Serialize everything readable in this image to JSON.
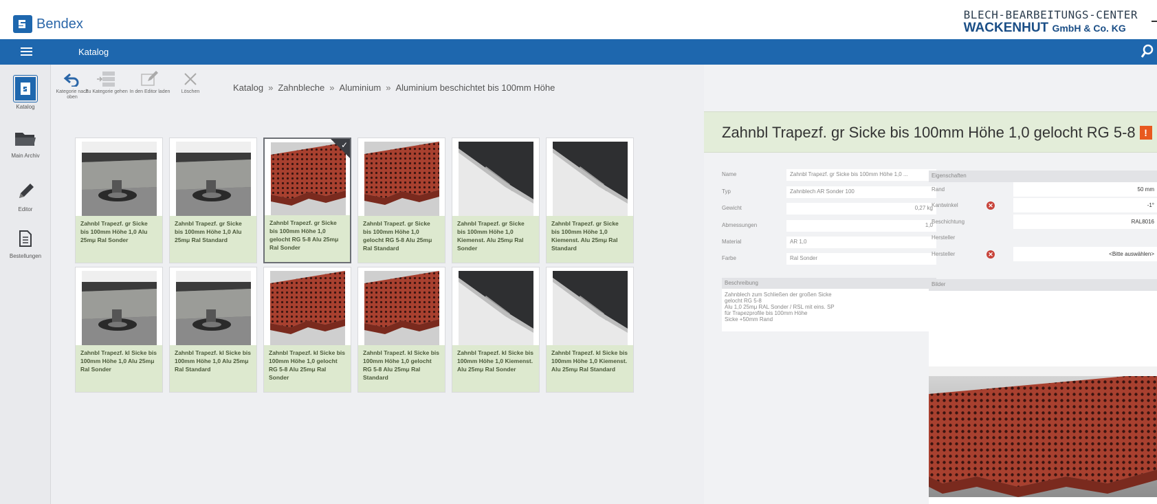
{
  "app": {
    "logo_text": "Bendex"
  },
  "company": {
    "line1": "BLECH-BEARBEITUNGS-CENTER",
    "line2": "WACKENHUT",
    "line2_suffix": "GmbH & Co. KG"
  },
  "navbar": {
    "title": "Katalog"
  },
  "sidebar": [
    {
      "label": "Katalog",
      "icon": "catalog-icon",
      "active": true
    },
    {
      "label": "Main Archiv",
      "icon": "folder-icon"
    },
    {
      "label": "Editor",
      "icon": "pencil-icon"
    },
    {
      "label": "Bestellungen",
      "icon": "document-icon"
    }
  ],
  "toolbar": [
    {
      "label": "Kategorie nach oben",
      "icon": "undo-arrow-icon"
    },
    {
      "label": "Zu Kategorie gehen",
      "icon": "goto-category-icon"
    },
    {
      "label": "In den Editor laden",
      "icon": "edit-icon"
    },
    {
      "label": "Löschen",
      "icon": "delete-x-icon"
    }
  ],
  "breadcrumb": [
    "Katalog",
    "Zahnbleche",
    "Aluminium",
    "Aluminium beschichtet bis 100mm Höhe"
  ],
  "breadcrumb_sep": "»",
  "cards": [
    {
      "caption": "Zahnbl Trapezf. gr Sicke bis 100mm Höhe 1,0 Alu 25mμ Ral Sonder",
      "img": "foot"
    },
    {
      "caption": "Zahnbl Trapezf. gr Sicke bis 100mm Höhe 1,0 Alu 25mμ Ral Standard",
      "img": "foot"
    },
    {
      "caption": "Zahnbl Trapezf. gr Sicke bis 100mm Höhe 1,0 gelocht RG 5-8 Alu 25mμ Ral Sonder",
      "img": "perforated",
      "selected": true
    },
    {
      "caption": "Zahnbl Trapezf. gr Sicke bis 100mm Höhe 1,0 gelocht RG 5-8 Alu 25mμ Ral Standard",
      "img": "perforated"
    },
    {
      "caption": "Zahnbl Trapezf. gr Sicke bis 100mm Höhe 1,0 Kiemenst. Alu 25mμ Ral Sonder",
      "img": "louver"
    },
    {
      "caption": "Zahnbl Trapezf. gr Sicke bis 100mm Höhe 1,0 Kiemenst. Alu 25mμ Ral Standard",
      "img": "louver"
    },
    {
      "caption": "Zahnbl Trapezf. kl Sicke bis 100mm Höhe 1,0 Alu 25mμ Ral Sonder",
      "img": "foot"
    },
    {
      "caption": "Zahnbl Trapezf. kl Sicke bis 100mm Höhe 1,0 Alu 25mμ Ral Standard",
      "img": "foot"
    },
    {
      "caption": "Zahnbl Trapezf. kl Sicke bis 100mm Höhe 1,0 gelocht RG 5-8 Alu 25mμ Ral Sonder",
      "img": "perforated"
    },
    {
      "caption": "Zahnbl Trapezf. kl Sicke bis 100mm Höhe 1,0 gelocht RG 5-8 Alu 25mμ Ral Standard",
      "img": "perforated"
    },
    {
      "caption": "Zahnbl Trapezf. kl Sicke bis 100mm Höhe 1,0 Kiemenst. Alu 25mμ Ral Sonder",
      "img": "louver"
    },
    {
      "caption": "Zahnbl Trapezf. kl Sicke bis 100mm Höhe 1,0 Kiemenst. Alu 25mμ Ral Standard",
      "img": "louver"
    }
  ],
  "detail": {
    "title": "Zahnbl Trapezf. gr Sicke bis 100mm Höhe 1,0 gelocht RG 5-8",
    "warning": "!",
    "fields": [
      {
        "label": "Name",
        "value": "Zahnbl Trapezf. gr Sicke bis 100mm Höhe 1,0 ..."
      },
      {
        "label": "Typ",
        "value": "Zahnblech AR Sonder 100"
      },
      {
        "label": "Gewicht",
        "value": "0,27 kg",
        "align": "right"
      },
      {
        "label": "Abmessungen",
        "value": "1,0",
        "align": "right"
      },
      {
        "label": "Material",
        "value": "AR 1,0"
      },
      {
        "label": "Farbe",
        "value": "Ral Sonder"
      }
    ],
    "description_header": "Beschreibung",
    "description": "Zahnblech zum Schließen der großen Sicke\ngelocht RG 5-8\nAlu 1,0 25mμ RAL Sonder / RSL mit eins. SP\nfür Trapezprofile bis 100mm Höhe\nSicke +50mm Rand",
    "properties_header": "Eigenschaften",
    "properties": [
      {
        "label": "Rand",
        "value": "50 mm"
      },
      {
        "label": "Kantwinkel",
        "value": "-1°",
        "error": true
      },
      {
        "label": "Beschichtung",
        "value": "RAL8016"
      },
      {
        "label": "Hersteller",
        "value": "",
        "plain": true
      },
      {
        "label": "Hersteller",
        "value": "<Bitte auswählen>",
        "error": true
      }
    ],
    "images_header": "Bilder"
  },
  "colors": {
    "brand": "#1e67ae",
    "caption_bg": "#dde9cf",
    "detail_head_bg": "#e3edd9",
    "warning": "#e8591f",
    "error": "#c8443b"
  }
}
